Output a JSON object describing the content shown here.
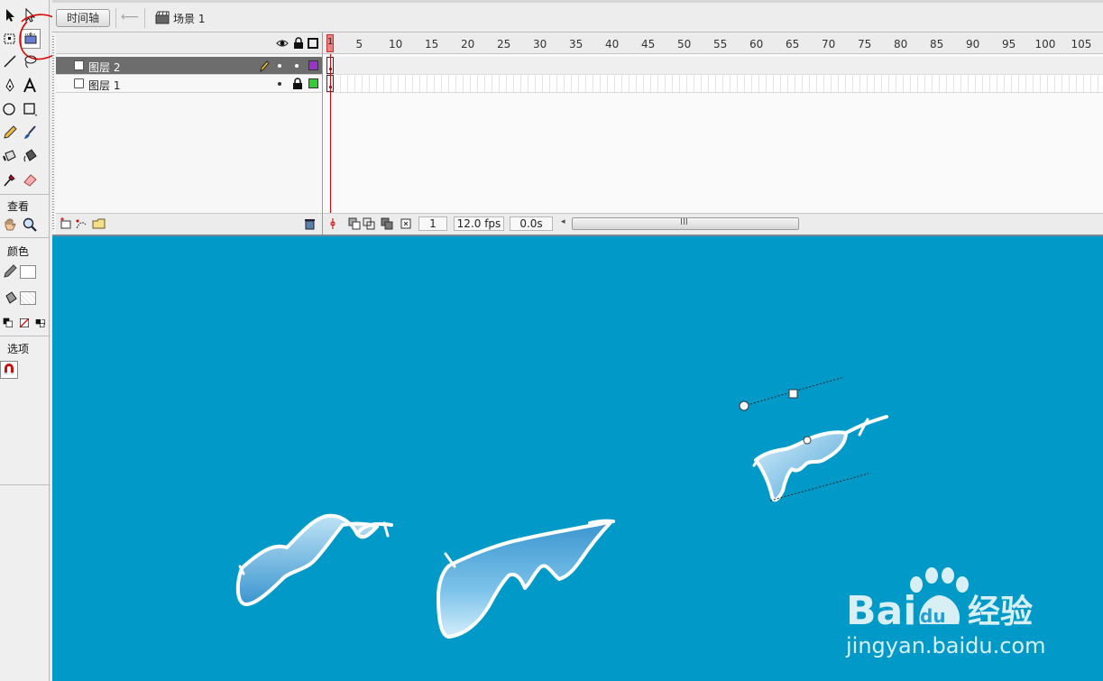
{
  "header": {
    "timeline_button": "时间轴",
    "scene_label": "场景 1"
  },
  "tools_panel": {
    "view_label": "查看",
    "colors_label": "颜色",
    "options_label": "选项"
  },
  "layers": [
    {
      "name": "图层 2",
      "selected": true,
      "color": "#9933cc"
    },
    {
      "name": "图层 1",
      "selected": false,
      "color": "#33cc33"
    }
  ],
  "ruler": {
    "current_frame_marker": "1",
    "ticks": [
      "5",
      "10",
      "15",
      "20",
      "25",
      "30",
      "35",
      "40",
      "45",
      "50",
      "55",
      "60",
      "65",
      "70",
      "75",
      "80",
      "85",
      "90",
      "95",
      "100",
      "105"
    ]
  },
  "timeline_status": {
    "current_frame": "1",
    "frame_rate": "12.0 fps",
    "elapsed_time": "0.0s"
  },
  "colors": {
    "stage_background": "#0099c8",
    "highlight_circle": "#e00000"
  },
  "watermark": {
    "brand": "Bai du 经验",
    "url": "jingyan.baidu.com"
  }
}
